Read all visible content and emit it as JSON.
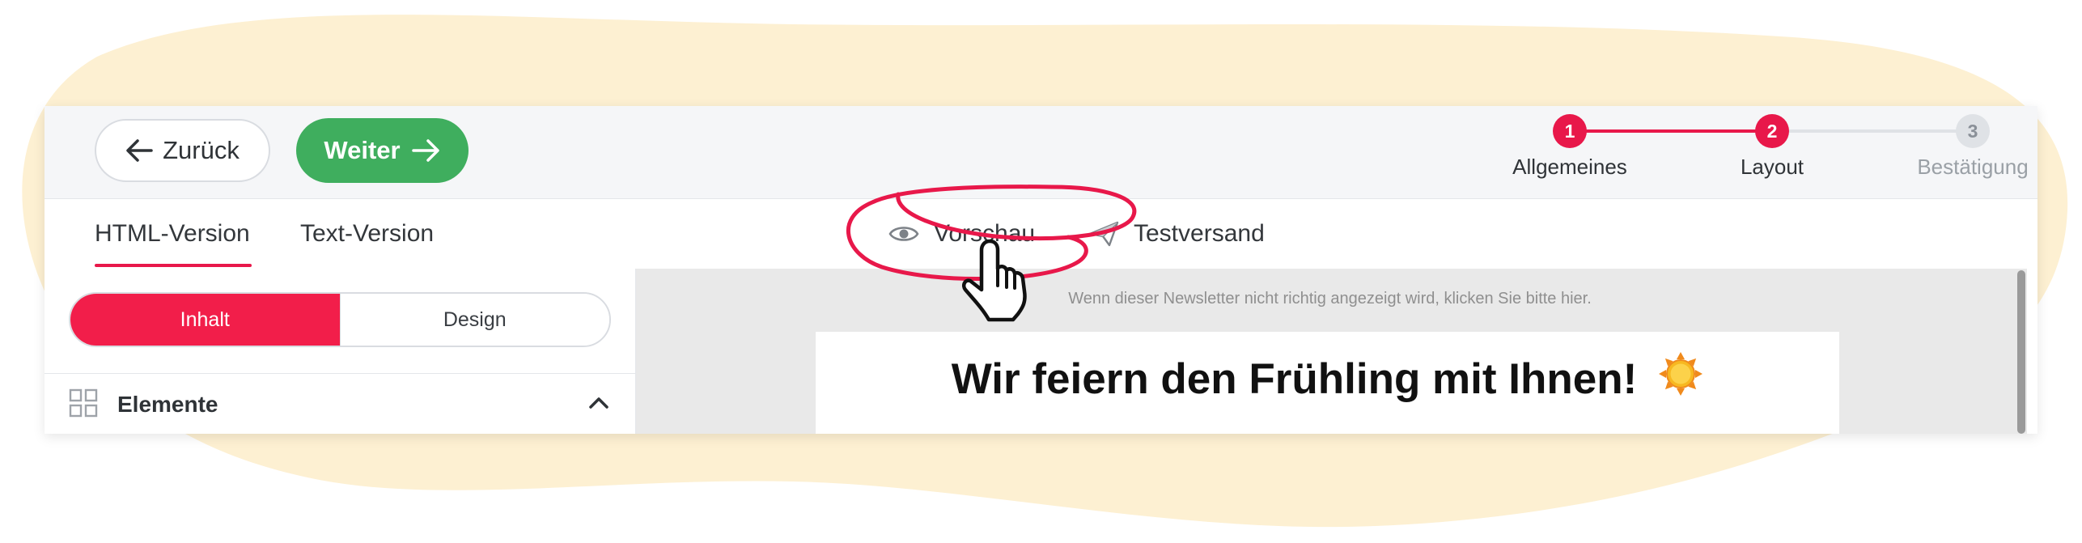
{
  "toolbar": {
    "back_label": "Zurück",
    "next_label": "Weiter"
  },
  "stepper": {
    "steps": [
      {
        "number": "1",
        "label": "Allgemeines",
        "state": "done"
      },
      {
        "number": "2",
        "label": "Layout",
        "state": "active"
      },
      {
        "number": "3",
        "label": "Bestätigung",
        "state": "pending"
      }
    ]
  },
  "tabs": {
    "items": [
      {
        "label": "HTML-Version",
        "active": true
      },
      {
        "label": "Text-Version",
        "active": false
      }
    ],
    "preview_label": "Vorschau",
    "test_send_label": "Testversand"
  },
  "sidebar": {
    "segments": [
      {
        "label": "Inhalt",
        "active": true
      },
      {
        "label": "Design",
        "active": false
      }
    ],
    "elements_label": "Elemente"
  },
  "preview": {
    "notice": "Wenn dieser Newsletter nicht richtig angezeigt wird, klicken Sie bitte hier.",
    "headline": "Wir feiern den Frühling mit Ihnen!",
    "headline_emoji": "sun-icon"
  },
  "colors": {
    "accent_red": "#e8184a",
    "green": "#3fae5e",
    "blob": "#fdf0d2",
    "step_pending": "#dfe2e6"
  }
}
